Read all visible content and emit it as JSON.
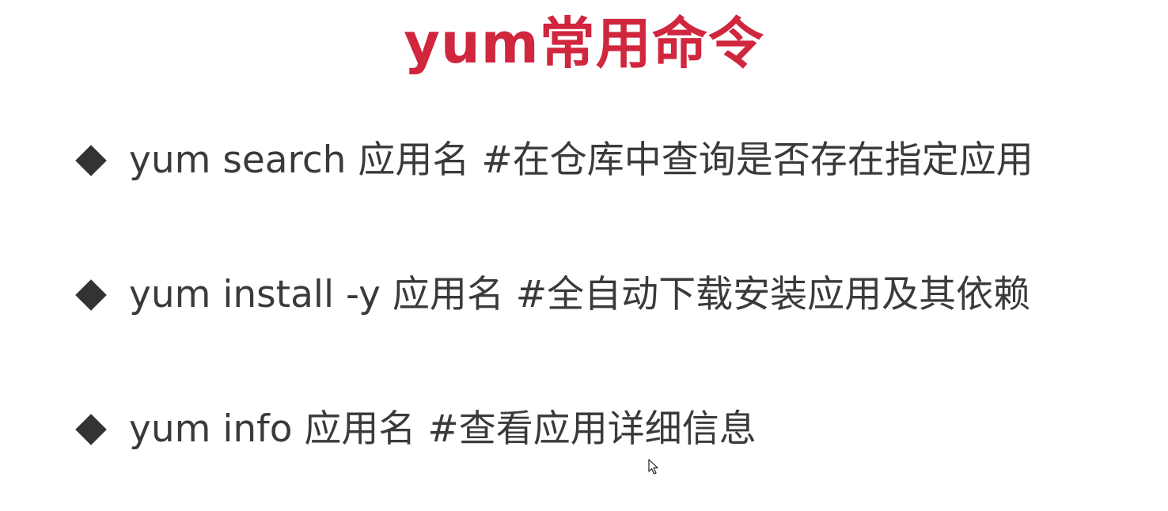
{
  "slide": {
    "title": "yum常用命令",
    "bullets": [
      {
        "text": "yum search 应用名 #在仓库中查询是否存在指定应用"
      },
      {
        "text": "yum install -y 应用名 #全自动下载安装应用及其依赖"
      },
      {
        "text": "yum info 应用名 #查看应用详细信息"
      }
    ]
  },
  "colors": {
    "title": "#d0263e",
    "text": "#3a3a3a",
    "bullet": "#333333",
    "background": "#ffffff"
  },
  "icons": {
    "bullet": "diamond-bullet-icon",
    "cursor": "mouse-pointer-icon"
  }
}
